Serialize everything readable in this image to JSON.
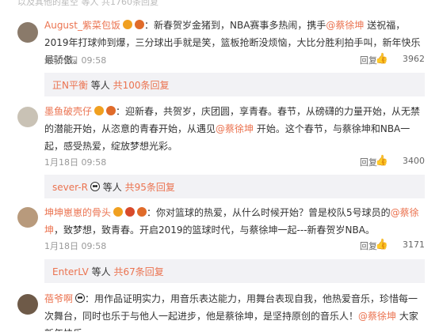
{
  "top_partial": "以及其他的星空 等人 共1760条回复",
  "comments": [
    {
      "username": "August_紫菜包饭",
      "text_1": "：新春贺岁金猪到，NBA赛事多热闹，携手",
      "at_1": "@蔡徐坤",
      "text_2": " 送祝福，2019年打球帅到爆，三分球出手就是笑，篮板抢断没烦恼，大比分胜利拍手叫，新年快乐最骄傲。",
      "time": "1月18日 09:58",
      "reply_label": "回复",
      "likes": "3962",
      "sub_user": "正N平衡",
      "sub_mid": " 等人 ",
      "sub_more": "共100条回复"
    },
    {
      "username": "墨鱼破壳仔",
      "text_1": "：迎新春，共贺岁，庆团圆，享青春。春节，从磅礴的力量开始，从无禁的潜能开始，从恣意的青春开始，从遇见",
      "at_1": "@蔡徐坤",
      "text_2": " 开始。这个春节，与蔡徐坤和NBA一起，感受热爱，绽放梦想光彩。",
      "time": "1月18日 09:58",
      "reply_label": "回复",
      "likes": "3400",
      "sub_user": "sever-R",
      "sub_mid": " 等人 ",
      "sub_more": "共95条回复"
    },
    {
      "username": "坤坤崽崽的骨头",
      "text_1": "：你对篮球的热爱，从什么时候开始？曾是校队5号球员的",
      "at_1": "@蔡徐坤",
      "text_2": "，致梦想，致青春。开启2019的篮球时代，与蔡徐坤一起---新春贺岁NBA。",
      "time": "1月18日 09:58",
      "reply_label": "回复",
      "likes": "3171",
      "sub_user": "EnterLV",
      "sub_mid": " 等人 ",
      "sub_more": "共67条回复"
    },
    {
      "username": "蓓爷啊",
      "text_1": "：用作品证明实力，用音乐表达能力，用舞台表现自我，他热爱音乐，珍惜每一次舞台，同时也乐于与他人一起进步，他是蔡徐坤，是坚持原创的音乐人！",
      "at_1": "@蔡徐坤",
      "text_2": " 大家新年快乐"
    }
  ],
  "colors": {
    "accent": "#eb7350",
    "subbg": "#f2f2f5"
  }
}
